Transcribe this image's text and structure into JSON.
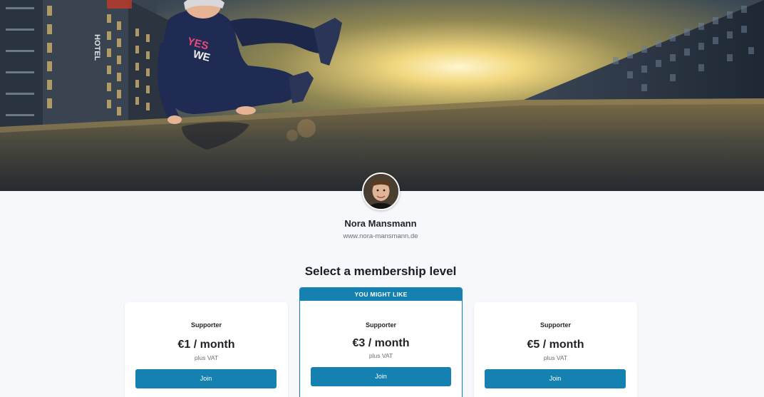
{
  "cover": {
    "image": "cover-photo-parkour",
    "hotel_sign": "HOTEL",
    "shirt_text_1": "YES",
    "shirt_text_2": "WE"
  },
  "profile": {
    "avatar": "avatar",
    "name": "Nora Mansmann",
    "website": "www.nora-mansmann.de"
  },
  "section_title": "Select a membership level",
  "tiers": [
    {
      "name": "Supporter",
      "price": "€1 / month",
      "vat": "plus VAT",
      "button": "Join",
      "highlighted": false
    },
    {
      "badge": "YOU MIGHT LIKE",
      "name": "Supporter",
      "price": "€3 / month",
      "vat": "plus VAT",
      "button": "Join",
      "highlighted": true
    },
    {
      "name": "Supporter",
      "price": "€5 / month",
      "vat": "plus VAT",
      "button": "Join",
      "highlighted": false
    }
  ],
  "colors": {
    "accent": "#1481b0",
    "page_background": "#f7f8fb",
    "card_background": "#ffffff"
  }
}
